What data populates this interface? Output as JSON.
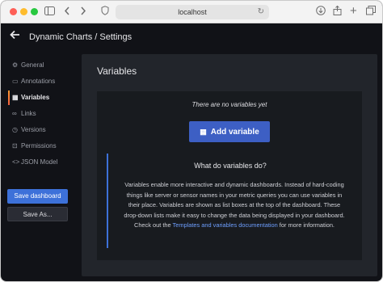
{
  "browser": {
    "url": "localhost"
  },
  "header": {
    "title": "Dynamic Charts / Settings"
  },
  "sidebar": {
    "items": [
      {
        "label": "General",
        "icon": "sliders-icon",
        "active": false
      },
      {
        "label": "Annotations",
        "icon": "comment-icon",
        "active": false
      },
      {
        "label": "Variables",
        "icon": "calculator-icon",
        "active": true
      },
      {
        "label": "Links",
        "icon": "link-icon",
        "active": false
      },
      {
        "label": "Versions",
        "icon": "history-icon",
        "active": false
      },
      {
        "label": "Permissions",
        "icon": "lock-icon",
        "active": false
      },
      {
        "label": "JSON Model",
        "icon": "code-icon",
        "active": false
      }
    ],
    "save_label": "Save dashboard",
    "save_as_label": "Save As..."
  },
  "main": {
    "title": "Variables",
    "empty_message": "There are no variables yet",
    "add_button_label": "Add variable",
    "callout": {
      "title": "What do variables do?",
      "body_before": "Variables enable more interactive and dynamic dashboards. Instead of hard-coding things like server or sensor names in your metric queries you can use variables in their place. Variables are shown as list boxes at the top of the dashboard. These drop-down lists make it easy to change the data being displayed in your dashboard. Check out the ",
      "link_text": "Templates and variables documentation",
      "body_after": " for more information."
    }
  },
  "colors": {
    "accent": "#3d71d9",
    "background": "#111217",
    "panel": "#22252b",
    "link": "#6e9fff"
  }
}
